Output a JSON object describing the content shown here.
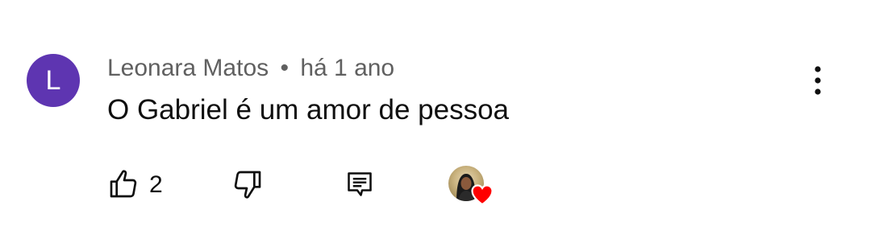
{
  "comment": {
    "avatar_letter": "L",
    "avatar_color": "#5e35b1",
    "author": "Leonara Matos",
    "separator": "•",
    "time": "há 1 ano",
    "text": "O Gabriel é um amor de pessoa"
  },
  "actions": {
    "like_icon": "thumbs-up-icon",
    "like_count": "2",
    "dislike_icon": "thumbs-down-icon",
    "reply_icon": "reply-icon",
    "creator_heart_icon": "heart-icon",
    "heart_color": "#ff0000"
  },
  "menu": {
    "icon": "more-vertical-icon"
  }
}
